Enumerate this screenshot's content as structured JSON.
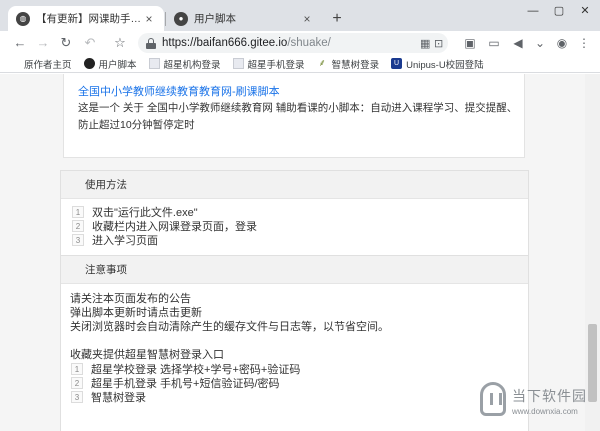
{
  "tabs": [
    {
      "label": "【有更新】网课助手专用浏览器",
      "favicon": "globe-icon"
    },
    {
      "label": "用户脚本",
      "favicon": "github-icon"
    }
  ],
  "window_controls": [
    "—",
    "▢",
    "✕"
  ],
  "omnibox": {
    "host": "https://baifan666.gitee.io",
    "path": "/shuake/"
  },
  "bookmarks": [
    {
      "label": "原作者主页",
      "icon": ""
    },
    {
      "label": "用户脚本",
      "icon": "github-icon"
    },
    {
      "label": "超星机构登录",
      "icon": "page-icon"
    },
    {
      "label": "超星手机登录",
      "icon": "page-icon"
    },
    {
      "label": "智慧树登录",
      "icon": "leaf-icon"
    },
    {
      "label": "Unipus-U校园登陆",
      "icon": "unipus-icon"
    }
  ],
  "script_card": {
    "title": "全国中小学教师继续教育教育网-刷课脚本",
    "description": "这是一个 关于 全国中小学教师继续教育网 辅助看课的小脚本：自动进入课程学习、提交提醒、防止超过10分钟暂停定时"
  },
  "usage": {
    "heading": "使用方法",
    "steps": [
      {
        "num": "1",
        "text": "双击\"运行此文件.exe\""
      },
      {
        "num": "2",
        "text": "收藏栏内进入网课登录页面，登录"
      },
      {
        "num": "3",
        "text": "进入学习页面"
      }
    ]
  },
  "notice": {
    "heading": "注意事项",
    "lines": [
      "请关注本页面发布的公告",
      "弹出脚本更新时请点击更新",
      "关闭浏览器时会自动清除产生的缓存文件与日志等，以节省空间。"
    ],
    "entry_title": "收藏夹提供超星智慧树登录入口",
    "entries": [
      {
        "num": "1",
        "text": "超星学校登录 选择学校+学号+密码+验证码"
      },
      {
        "num": "2",
        "text": "超星手机登录 手机号+短信验证码/密码"
      },
      {
        "num": "3",
        "text": "智慧树登录"
      }
    ]
  },
  "watermark": {
    "cn": "当下软件园",
    "en": "www.downxia.com"
  }
}
